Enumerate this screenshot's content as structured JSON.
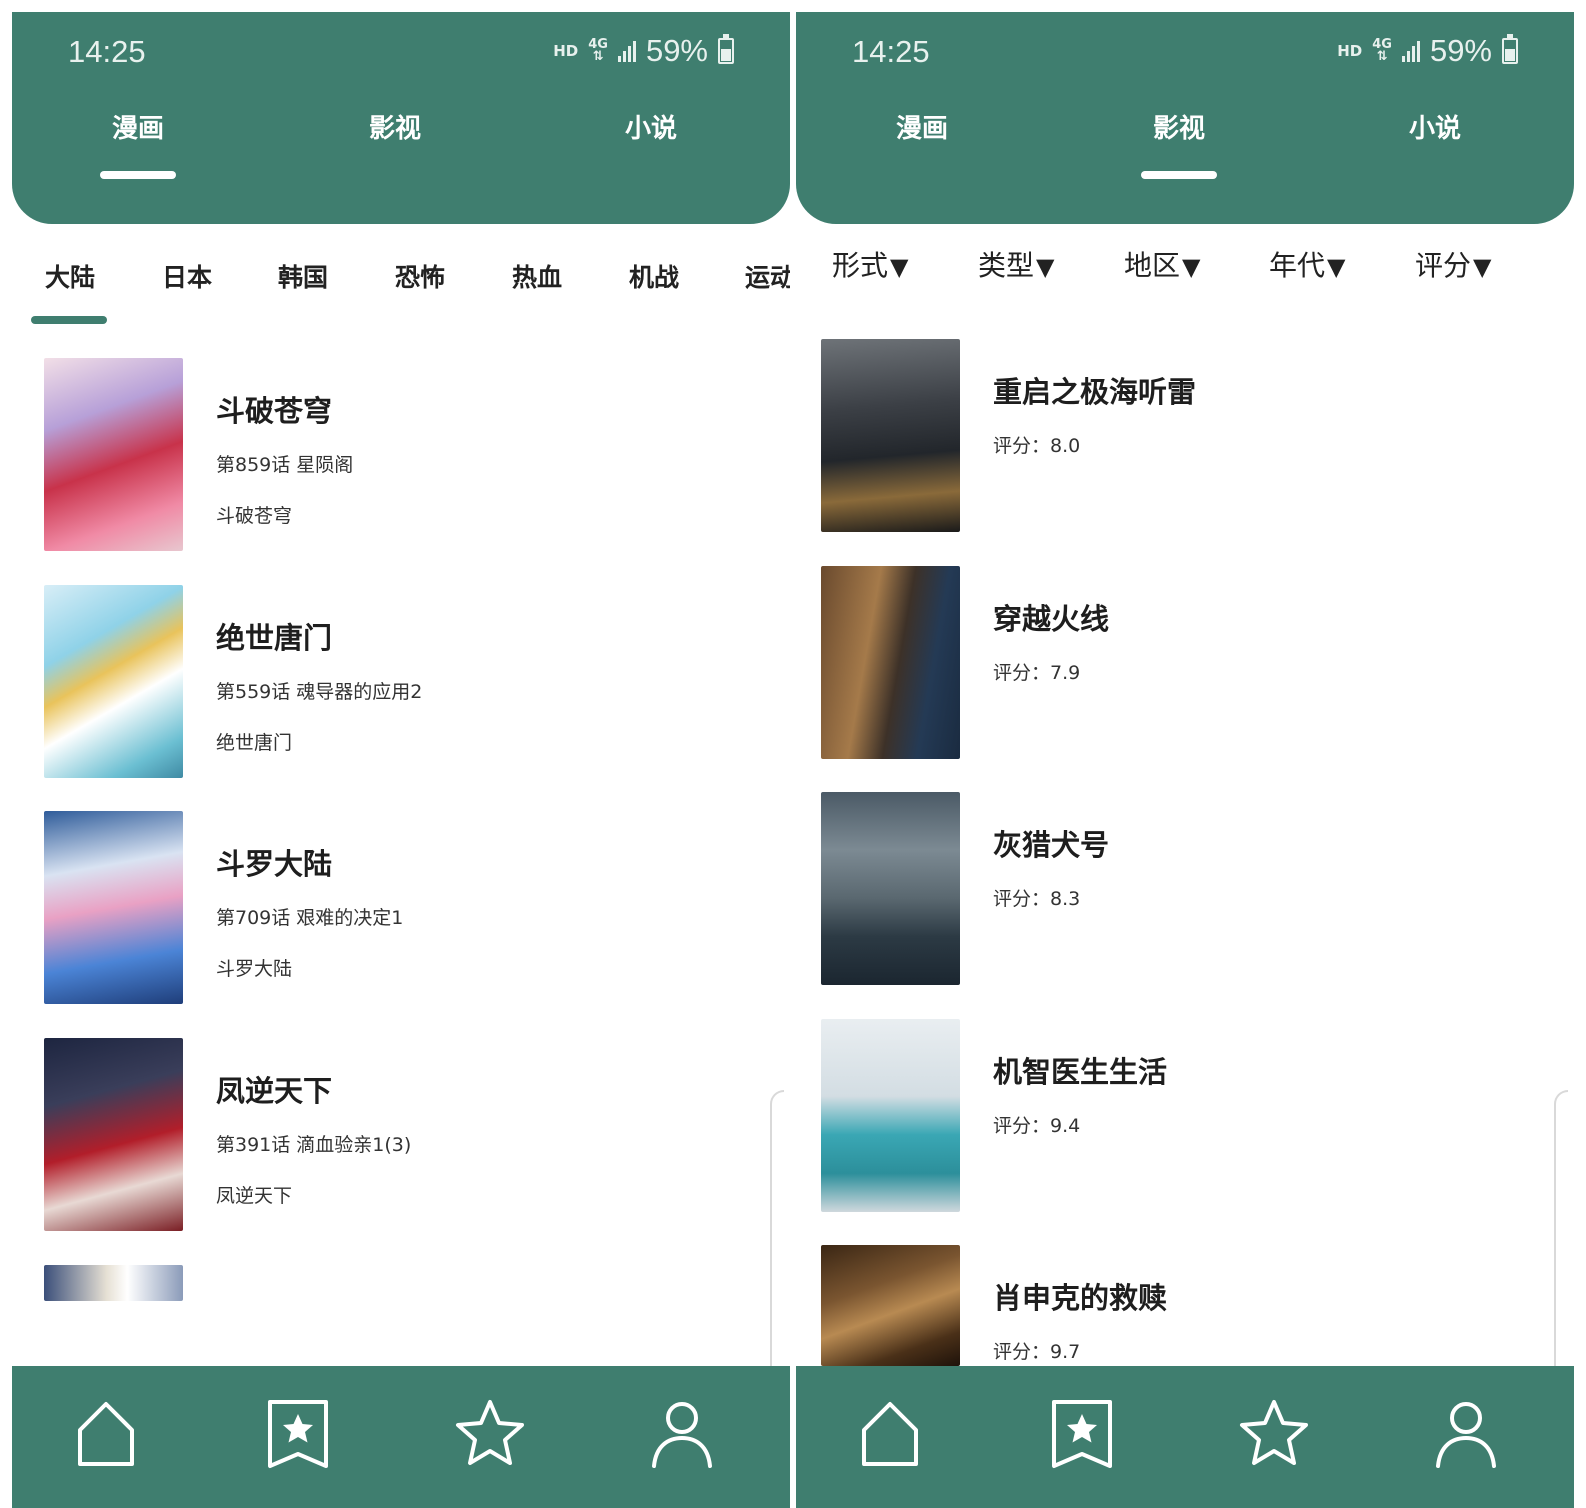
{
  "status_bar": {
    "time": "14:25",
    "hd": "HD",
    "network": "4G",
    "battery": "59%"
  },
  "top_tabs": [
    "漫画",
    "影视",
    "小说"
  ],
  "left_screen": {
    "active_tab": 0,
    "categories": [
      "大陆",
      "日本",
      "韩国",
      "恐怖",
      "热血",
      "机战",
      "运动"
    ],
    "items": [
      {
        "title": "斗破苍穹",
        "chapter": "第859话 星陨阁",
        "subtitle": "斗破苍穹"
      },
      {
        "title": "绝世唐门",
        "chapter": "第559话 魂导器的应用2",
        "subtitle": "绝世唐门"
      },
      {
        "title": "斗罗大陆",
        "chapter": "第709话 艰难的决定1",
        "subtitle": "斗罗大陆"
      },
      {
        "title": "凤逆天下",
        "chapter": "第391话 滴血验亲1(3)",
        "subtitle": "凤逆天下"
      }
    ]
  },
  "right_screen": {
    "active_tab": 1,
    "filters": [
      "形式",
      "类型",
      "地区",
      "年代",
      "评分"
    ],
    "filter_arrow": "▼",
    "items": [
      {
        "title": "重启之极海听雷",
        "rating": "评分：8.0"
      },
      {
        "title": "穿越火线",
        "rating": "评分：7.9"
      },
      {
        "title": "灰猎犬号",
        "rating": "评分：8.3"
      },
      {
        "title": "机智医生生活",
        "rating": "评分：9.4"
      },
      {
        "title": "肖申克的救赎",
        "rating": "评分：9.7"
      }
    ]
  },
  "bottom_nav": [
    "home-icon",
    "bookmark-star-icon",
    "star-icon",
    "user-icon"
  ],
  "colors": {
    "primary": "#3f7e6f",
    "text": "#222222",
    "white": "#ffffff"
  }
}
